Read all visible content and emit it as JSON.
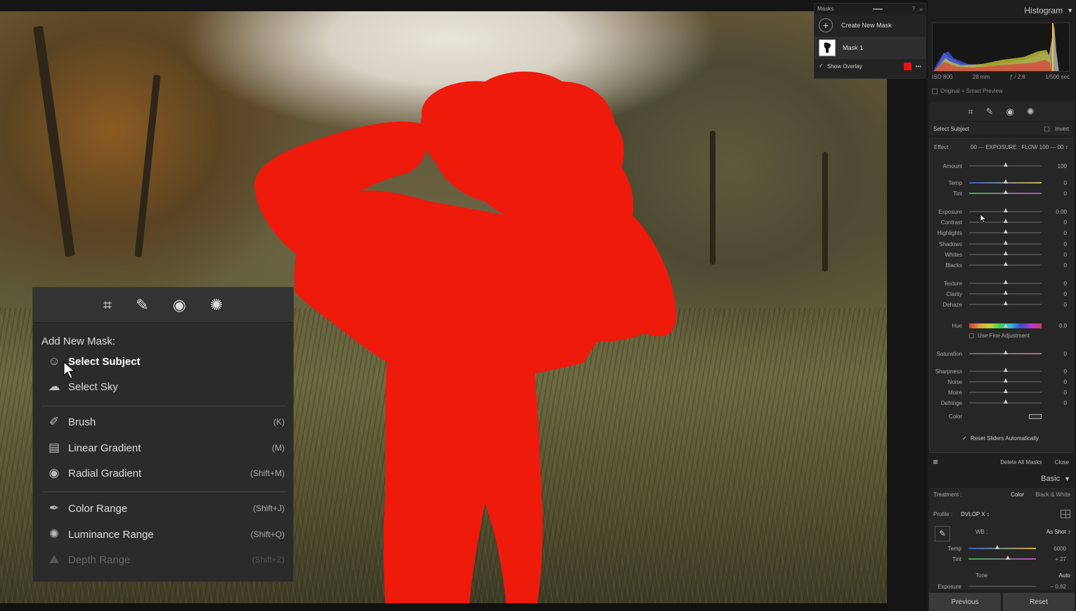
{
  "masks_panel": {
    "title": "Masks",
    "create_label": "Create New Mask",
    "mask_name": "Mask 1",
    "show_overlay": "Show Overlay",
    "overlay_color": "#e8150f",
    "more": "•••",
    "info": "?",
    "collapse": "»"
  },
  "histogram": {
    "title": "Histogram",
    "iso": "ISO 800",
    "focal": "28 mm",
    "aperture": "ƒ / 2.8",
    "shutter": "1/500 sec",
    "preview": "Original + Smart Preview"
  },
  "mask_edit": {
    "subject_label": "Select Subject",
    "invert_label": "Invert",
    "effect_label": "Effect :",
    "effect_value": "00 --- EXPOSURE : FLOW 100 --- 00 ↕",
    "sliders": [
      {
        "name": "Amount",
        "value": "100",
        "pos": 0.5,
        "type": ""
      },
      {
        "name": "Temp",
        "value": "0",
        "pos": 0.5,
        "type": "temp"
      },
      {
        "name": "Tint",
        "value": "0",
        "pos": 0.5,
        "type": "tint"
      },
      {
        "name": "Exposure",
        "value": "0.00",
        "pos": 0.5,
        "type": ""
      },
      {
        "name": "Contrast",
        "value": "0",
        "pos": 0.5,
        "type": ""
      },
      {
        "name": "Highlights",
        "value": "0",
        "pos": 0.5,
        "type": ""
      },
      {
        "name": "Shadows",
        "value": "0",
        "pos": 0.5,
        "type": ""
      },
      {
        "name": "Whites",
        "value": "0",
        "pos": 0.5,
        "type": ""
      },
      {
        "name": "Blacks",
        "value": "0",
        "pos": 0.5,
        "type": ""
      },
      {
        "name": "Texture",
        "value": "0",
        "pos": 0.5,
        "type": ""
      },
      {
        "name": "Clarity",
        "value": "0",
        "pos": 0.5,
        "type": ""
      },
      {
        "name": "Dehaze",
        "value": "0",
        "pos": 0.5,
        "type": ""
      },
      {
        "name": "Hue",
        "value": "0.0",
        "pos": 0.5,
        "type": "hue"
      },
      {
        "name": "Saturation",
        "value": "0",
        "pos": 0.5,
        "type": "sat"
      },
      {
        "name": "Sharpness",
        "value": "0",
        "pos": 0.5,
        "type": ""
      },
      {
        "name": "Noise",
        "value": "0",
        "pos": 0.5,
        "type": ""
      },
      {
        "name": "Moiré",
        "value": "0",
        "pos": 0.5,
        "type": ""
      },
      {
        "name": "Defringe",
        "value": "0",
        "pos": 0.5,
        "type": ""
      }
    ],
    "fine_adjust": "Use Fine Adjustment",
    "color_label": "Color",
    "reset_label": "Reset Sliders Automatically",
    "delete_all": "Delete All Masks",
    "close": "Close"
  },
  "basic": {
    "title": "Basic",
    "treatment_label": "Treatment :",
    "treatment_color": "Color",
    "treatment_bw": "Black & White",
    "profile_label": "Profile :",
    "profile_value": "DVLOP X ↕",
    "wb_label": "WB :",
    "wb_value": "As Shot ↕",
    "temp_label": "Temp",
    "temp_value": "6000",
    "temp_pos": 0.43,
    "tint_label": "Tint",
    "tint_value": "+ 27",
    "tint_pos": 0.58,
    "tone_label": "Tone",
    "tone_auto": "Auto",
    "exposure_label": "Exposure",
    "exposure_value": "− 0.62"
  },
  "buttons": {
    "previous": "Previous",
    "reset": "Reset"
  },
  "popup": {
    "title": "Add New Mask:",
    "items": [
      {
        "label": "Select Subject",
        "shortcut": ""
      },
      {
        "label": "Select Sky",
        "shortcut": ""
      },
      {
        "label": "Brush",
        "shortcut": "(K)"
      },
      {
        "label": "Linear Gradient",
        "shortcut": "(M)"
      },
      {
        "label": "Radial Gradient",
        "shortcut": "(Shift+M)"
      },
      {
        "label": "Color Range",
        "shortcut": "(Shift+J)"
      },
      {
        "label": "Luminance Range",
        "shortcut": "(Shift+Q)"
      },
      {
        "label": "Depth Range",
        "shortcut": "(Shift+Z)"
      }
    ]
  }
}
